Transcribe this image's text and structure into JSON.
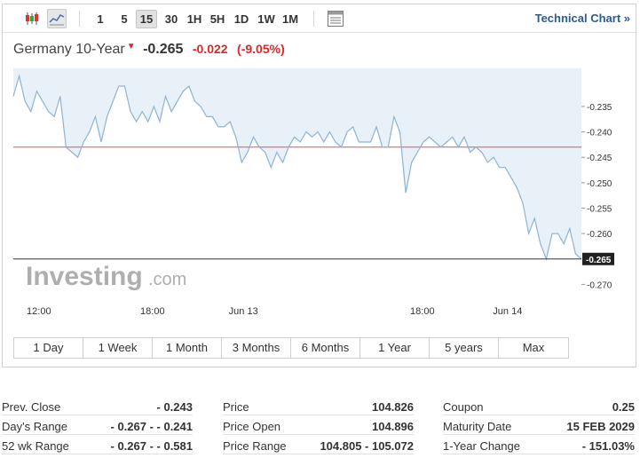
{
  "toolbar": {
    "intervals": [
      "1",
      "5",
      "15",
      "30",
      "1H",
      "5H",
      "1D",
      "1W",
      "1M"
    ],
    "active_interval": "15",
    "technical_chart_label": "Technical Chart »"
  },
  "instrument": {
    "name": "Germany 10-Year",
    "price": "-0.265",
    "change": "-0.022",
    "change_pct": "(-9.05%)"
  },
  "chart_data": {
    "type": "line",
    "ylim": [
      -0.2715,
      -0.2275
    ],
    "y_ticks": [
      "-0.235",
      "-0.240",
      "-0.245",
      "-0.250",
      "-0.255",
      "-0.260",
      "-0.265",
      "-0.270"
    ],
    "x_ticks": [
      "12:00",
      "18:00",
      "Jun 13",
      "18:00",
      "Jun 14"
    ],
    "prev_close": -0.243,
    "current_value": -0.265,
    "current_label": "-0.265",
    "watermark": "Investing.com",
    "series": [
      {
        "values": [
          -0.233,
          -0.229,
          -0.234,
          -0.236,
          -0.232,
          -0.234,
          -0.236,
          -0.237,
          -0.233,
          -0.243,
          -0.244,
          -0.245,
          -0.242,
          -0.24,
          -0.237,
          -0.242,
          -0.237,
          -0.234,
          -0.231,
          -0.231,
          -0.236,
          -0.238,
          -0.236,
          -0.238,
          -0.235,
          -0.238,
          -0.233,
          -0.236,
          -0.234,
          -0.232,
          -0.231,
          -0.234,
          -0.235,
          -0.237,
          -0.237,
          -0.239,
          -0.239,
          -0.238,
          -0.241,
          -0.246,
          -0.244,
          -0.241,
          -0.243,
          -0.244,
          -0.247,
          -0.244,
          -0.246,
          -0.243,
          -0.241,
          -0.242,
          -0.24,
          -0.241,
          -0.24,
          -0.242,
          -0.24,
          -0.242,
          -0.243,
          -0.24,
          -0.239,
          -0.242,
          -0.242,
          -0.242,
          -0.239,
          -0.243,
          -0.243,
          -0.237,
          -0.24,
          -0.252,
          -0.246,
          -0.244,
          -0.242,
          -0.241,
          -0.242,
          -0.243,
          -0.242,
          -0.241,
          -0.243,
          -0.241,
          -0.244,
          -0.243,
          -0.244,
          -0.246,
          -0.245,
          -0.247,
          -0.247,
          -0.249,
          -0.251,
          -0.254,
          -0.26,
          -0.257,
          -0.262,
          -0.265,
          -0.26,
          -0.26,
          -0.262,
          -0.259,
          -0.264,
          -0.265
        ]
      }
    ]
  },
  "range_buttons": [
    "1 Day",
    "1 Week",
    "1 Month",
    "3 Months",
    "6 Months",
    "1 Year",
    "5 years",
    "Max"
  ],
  "stats": {
    "col1": [
      {
        "label": "Prev. Close",
        "value": "- 0.243"
      },
      {
        "label": "Day's Range",
        "value": "- 0.267 - - 0.241"
      },
      {
        "label": "52 wk Range",
        "value": "- 0.267 - - 0.581"
      }
    ],
    "col2": [
      {
        "label": "Price",
        "value": "104.826"
      },
      {
        "label": "Price Open",
        "value": "104.896"
      },
      {
        "label": "Price Range",
        "value": "104.805 - 105.072"
      }
    ],
    "col3": [
      {
        "label": "Coupon",
        "value": "0.25"
      },
      {
        "label": "Maturity Date",
        "value": "15 FEB 2029"
      },
      {
        "label": "1-Year Change",
        "value": "- 151.03%"
      }
    ]
  },
  "colors": {
    "line": "#8db3d6",
    "area": "#e8f0f8",
    "prev_close": "#e05555",
    "current_line": "#333333",
    "negative": "#e02626",
    "link": "#2d5b8a"
  }
}
